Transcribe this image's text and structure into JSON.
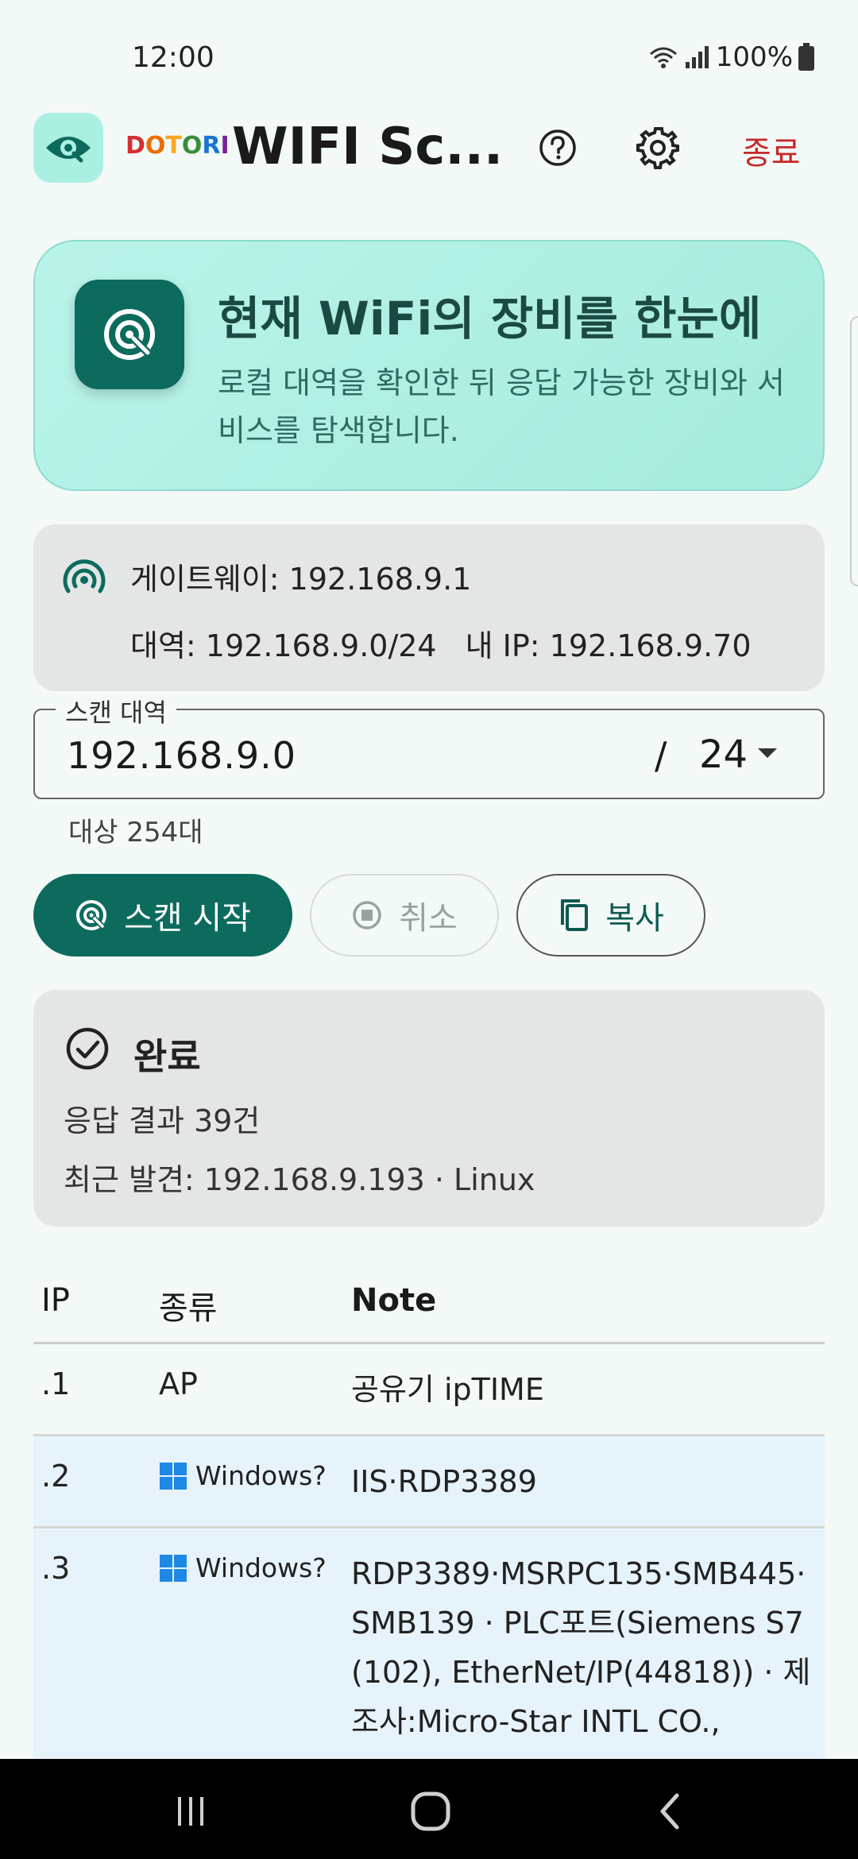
{
  "status_bar": {
    "time": "12:00",
    "battery": "100%"
  },
  "app_bar": {
    "brand_letters": [
      {
        "ch": "D",
        "color": "#d32f2f"
      },
      {
        "ch": "O",
        "color": "#ef6c00"
      },
      {
        "ch": "T",
        "color": "#f9a825"
      },
      {
        "ch": "O",
        "color": "#388e3c"
      },
      {
        "ch": "R",
        "color": "#1976d2"
      },
      {
        "ch": "I",
        "color": "#7b1fa2"
      }
    ],
    "title": "WIFI Sc...",
    "exit_label": "종료",
    "icons": [
      "eye-search-icon",
      "help-icon",
      "gear-icon"
    ]
  },
  "hero": {
    "title": "현재 WiFi의 장비를 한눈에",
    "description": "로컬 대역을 확인한 뒤 응답 가능한 장비와 서비스를 탐색합니다."
  },
  "network": {
    "gateway": "게이트웨이: 192.168.9.1",
    "subnet": "대역: 192.168.9.0/24",
    "my_ip": "내 IP: 192.168.9.70"
  },
  "scan_range": {
    "label": "스캔 대역",
    "value": "192.168.9.0",
    "slash": "/",
    "prefix": "24",
    "targets": "대상 254대"
  },
  "buttons": {
    "scan": "스캔 시작",
    "cancel": "취소",
    "copy": "복사"
  },
  "status": {
    "title": "완료",
    "count": "응답 결과 39건",
    "recent": "최근 발견: 192.168.9.193 · Linux"
  },
  "table": {
    "headers": {
      "ip": "IP",
      "kind": "종류",
      "note": "Note"
    },
    "rows": [
      {
        "ip": ".1",
        "kind": "AP",
        "note": "공유기 ipTIME"
      },
      {
        "ip": ".2",
        "kind": "Windows?",
        "note": "IIS·RDP3389"
      },
      {
        "ip": ".3",
        "kind": "Windows?",
        "note": "RDP3389·MSRPC135·SMB445·SMB139 · PLC포트(Siemens S7(102), EtherNet/IP(44818)) · 제조사:Micro-Star INTL CO.,"
      }
    ]
  },
  "colors": {
    "accent": "#0d6b5e",
    "hero_bg": "#b9f3e9",
    "exit": "#c62828"
  }
}
